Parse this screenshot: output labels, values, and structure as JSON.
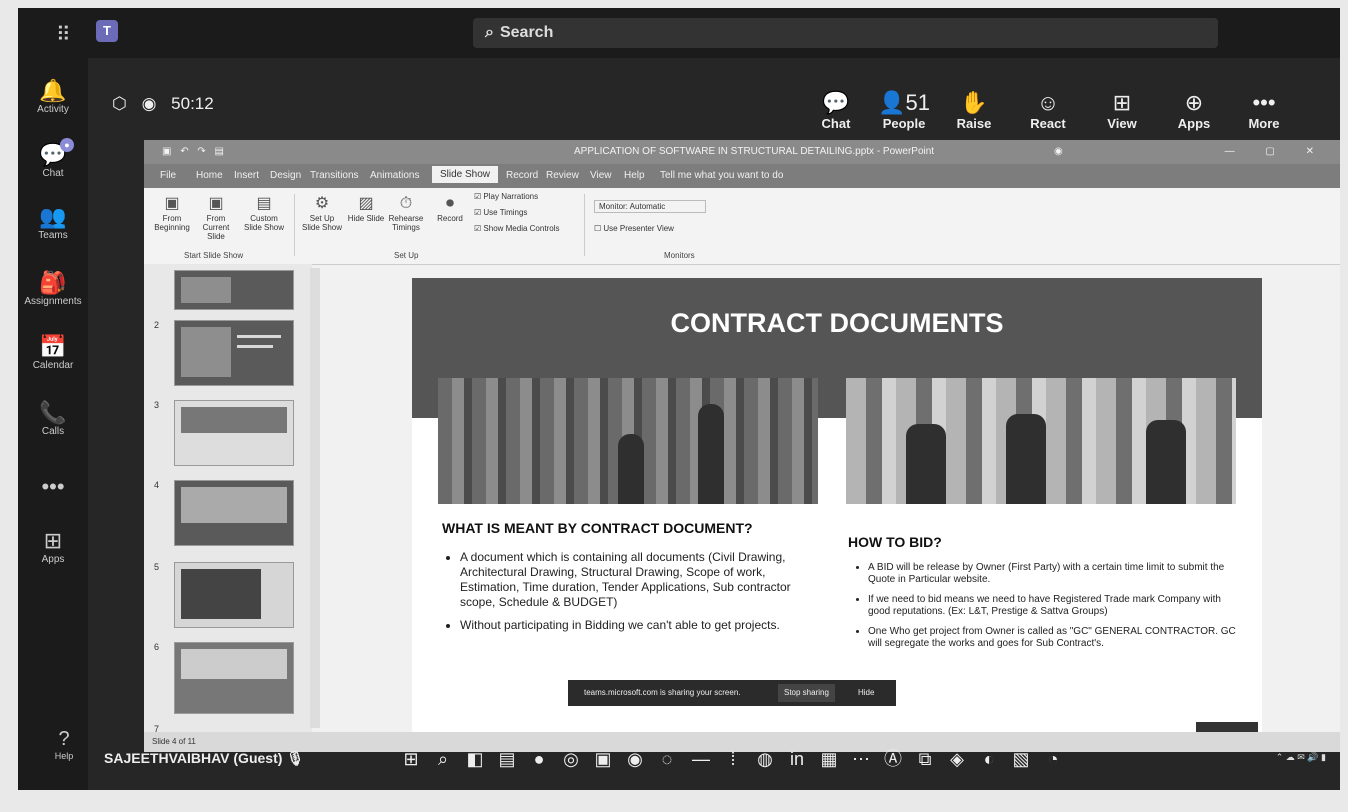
{
  "teams": {
    "search_label": "Search",
    "rail": [
      {
        "icon": "🔔",
        "label": "Activity"
      },
      {
        "icon": "💬",
        "label": "Chat"
      },
      {
        "icon": "👥",
        "label": "Teams"
      },
      {
        "icon": "🎒",
        "label": "Assignments"
      },
      {
        "icon": "📅",
        "label": "Calendar"
      },
      {
        "icon": "📞",
        "label": "Calls"
      },
      {
        "icon": "•••",
        "label": ""
      },
      {
        "icon": "⊞",
        "label": "Apps"
      }
    ],
    "help_label": "Help"
  },
  "meeting": {
    "timer": "50:12",
    "toolbar": [
      {
        "icon": "💬",
        "label": "Chat"
      },
      {
        "icon": "👤51",
        "label": "People"
      },
      {
        "icon": "✋",
        "label": "Raise"
      },
      {
        "icon": "☺",
        "label": "React"
      },
      {
        "icon": "⊞",
        "label": "View"
      },
      {
        "icon": "⊕",
        "label": "Apps"
      },
      {
        "icon": "•••",
        "label": "More"
      }
    ],
    "participant": "SAJEETHVAIBHAV (Guest)"
  },
  "ppt": {
    "title": "APPLICATION OF SOFTWARE IN STRUCTURAL DETAILING.pptx - PowerPoint",
    "tabs": [
      "File",
      "Home",
      "Insert",
      "Design",
      "Transitions",
      "Animations",
      "Slide Show",
      "Record",
      "Review",
      "View",
      "Help",
      "Tell me what you want to do"
    ],
    "active_tab": "Slide Show",
    "ribbon": {
      "from_beginning": "From Beginning",
      "from_current": "From Current Slide",
      "custom": "Custom Slide Show",
      "group_start": "Start Slide Show",
      "setup": "Set Up Slide Show",
      "hide": "Hide Slide",
      "rehearse": "Rehearse Timings",
      "record": "Record",
      "play_narrations": "Play Narrations",
      "use_timings": "Use Timings",
      "show_media": "Show Media Controls",
      "group_setup": "Set Up",
      "monitor": "Monitor: Automatic",
      "presenter_view": "Use Presenter View",
      "group_monitors": "Monitors"
    },
    "status": "Slide 4 of 11"
  },
  "slide": {
    "title": "CONTRACT DOCUMENTS",
    "left_heading": "WHAT IS MEANT BY CONTRACT DOCUMENT?",
    "left_bullets": [
      "A document which is containing all documents (Civil Drawing, Architectural Drawing, Structural Drawing, Scope of work, Estimation, Time duration, Tender Applications, Sub contractor scope, Schedule & BUDGET)",
      "Without participating in Bidding we can't able to get projects."
    ],
    "right_heading": "HOW TO BID?",
    "right_bullets": [
      "A BID will be release by Owner (First Party) with a certain time limit to submit the Quote in Particular website.",
      "If we need to bid means we need to have Registered Trade mark Company with good reputations. (Ex: L&T, Prestige & Sattva Groups)",
      "One Who get project from Owner is called as \"GC\" GENERAL CONTRACTOR. GC will segregate the works and goes for Sub Contract's."
    ]
  },
  "share_bar": {
    "message": "teams.microsoft.com is sharing your screen.",
    "stop": "Stop sharing",
    "hide": "Hide"
  }
}
